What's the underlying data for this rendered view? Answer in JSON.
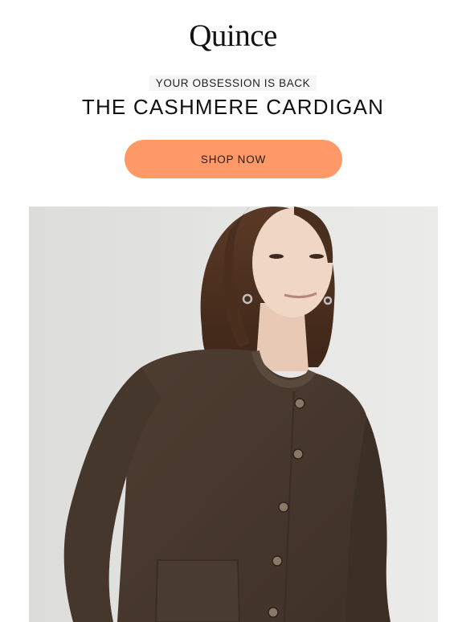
{
  "brand": {
    "logo_text": "Quince"
  },
  "hero_text": {
    "eyebrow": "YOUR OBSESSION IS BACK",
    "headline": "THE CASHMERE CARDIGAN"
  },
  "cta": {
    "label": "SHOP NOW",
    "color": "#ff9a68"
  },
  "hero_image": {
    "subject": "model-in-brown-cashmere-cardigan",
    "sweater_color": "#4a3a2e",
    "background_color": "#e3e3e1"
  }
}
